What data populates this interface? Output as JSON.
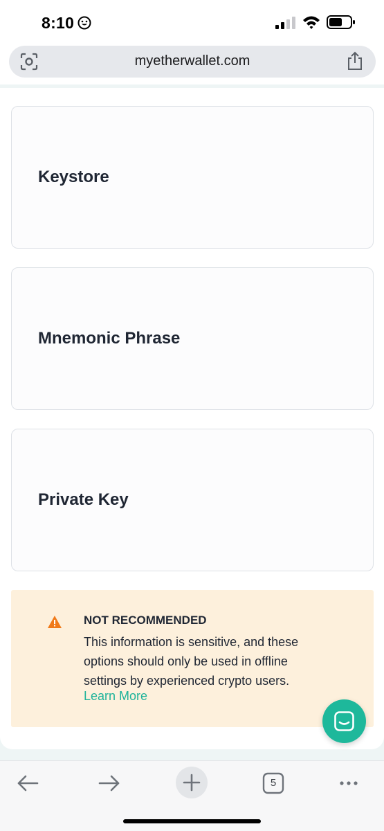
{
  "status_bar": {
    "time": "8:10",
    "icons": [
      "smiley-icon",
      "signal-icon",
      "wifi-icon",
      "battery-icon"
    ]
  },
  "browser": {
    "url": "myetherwallet.com",
    "icons": [
      "camera-search-icon",
      "share-icon"
    ]
  },
  "access_options": [
    {
      "label": "Keystore"
    },
    {
      "label": "Mnemonic Phrase"
    },
    {
      "label": "Private Key"
    }
  ],
  "warning": {
    "title": "NOT RECOMMENDED",
    "body": "This information is sensitive, and these options should only be used in offline settings by experienced crypto users.",
    "link": "Learn More",
    "icon": "warning-triangle-icon",
    "accent_color": "#f07a1a",
    "background_color": "#fdf0dc"
  },
  "chat": {
    "icon": "chat-icon",
    "color": "#1eb89b"
  },
  "toolbar": {
    "tab_count": "5",
    "icons": [
      "back-arrow-icon",
      "forward-arrow-icon",
      "plus-icon",
      "tabs-icon",
      "more-icon"
    ]
  },
  "colors": {
    "link": "#1fb39a",
    "text": "#1f2633"
  }
}
